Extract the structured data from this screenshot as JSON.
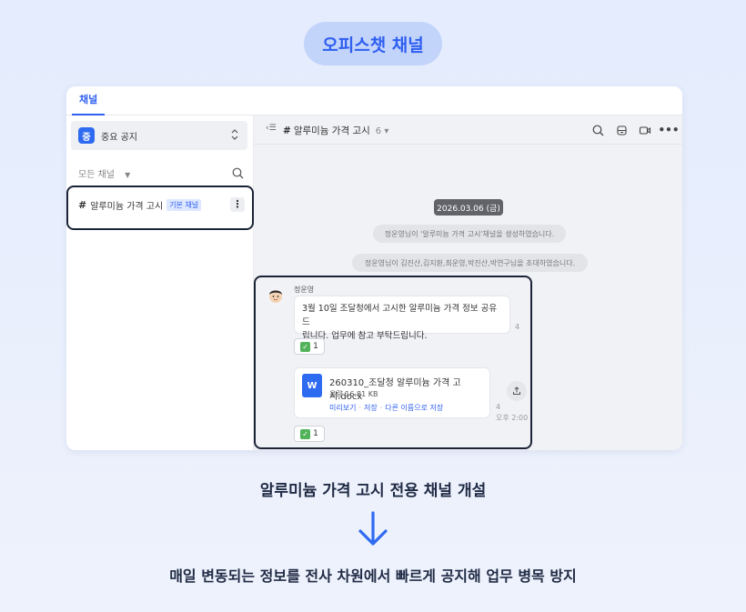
{
  "header_pill": "오피스챗 채널",
  "app": {
    "top_tab": "채널",
    "sidebar": {
      "channel_select": {
        "icon_char": "중",
        "label": "중요 공지"
      },
      "section_label": "모든 채널",
      "channels": [
        {
          "hash": "#",
          "name": "알루미늄 가격 고시",
          "badge": "기본 채널"
        }
      ]
    },
    "chat": {
      "hash": "#",
      "title": "알루미늄 가격 고시",
      "member_count": "6",
      "date_divider": "2026.03.06 (금)",
      "system_messages": [
        "정운영님이 '알루미늄 가격 고시'채널을 생성하였습니다.",
        "정운영님이 김진산,김지환,최운영,박진산,박연구님을 초대하였습니다."
      ],
      "message": {
        "author": "정운영",
        "text_line1": "3월 10일 조달청에서 고시한 알루미늄 가격 정보 공유드",
        "text_line2": "립니다. 업무에 참고 부탁드립니다.",
        "read_count": "4",
        "reaction_count": "1"
      },
      "file_message": {
        "icon_letter": "W",
        "filename": "260310_조달청 알루미늄 가격 고시.docx",
        "size": "용량 16.81 KB",
        "actions": [
          "미리보기",
          "저장",
          "다른 이름으로 저장"
        ],
        "read_count": "4",
        "time": "오후 2:00",
        "reaction_count": "1"
      }
    }
  },
  "caption_main": "알루미늄 가격 고시 전용 채널 개설",
  "caption_sub": "매일 변동되는 정보를 전사 차원에서 빠르게 공지해 업무 병목 방지",
  "colors": {
    "accent": "#2f5ff0",
    "highlight_border": "#1b2436",
    "pill_bg": "#c3d4fb"
  }
}
